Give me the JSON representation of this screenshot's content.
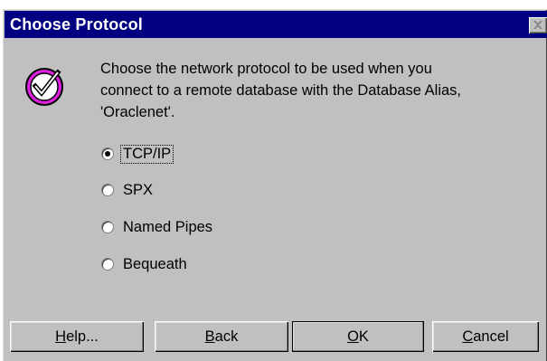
{
  "window": {
    "title": "Choose Protocol",
    "close_icon": "close-icon"
  },
  "message": {
    "icon": "checkmark-icon",
    "text": "Choose the network protocol to be used when you\nconnect to a remote database with the Database Alias,\n'Oraclenet'."
  },
  "protocols": [
    {
      "label": "TCP/IP",
      "selected": true
    },
    {
      "label": "SPX",
      "selected": false
    },
    {
      "label": "Named Pipes",
      "selected": false
    },
    {
      "label": "Bequeath",
      "selected": false
    }
  ],
  "buttons": {
    "help": {
      "mnemonic": "H",
      "rest": "elp..."
    },
    "back": {
      "mnemonic": "B",
      "rest": "ack"
    },
    "ok": {
      "mnemonic": "O",
      "rest": "K"
    },
    "cancel": {
      "mnemonic": "C",
      "rest": "ancel"
    }
  },
  "colors": {
    "title_bar": "#000080",
    "dialog_face": "#c0c0c0",
    "icon_magenta": "#e020e0"
  }
}
